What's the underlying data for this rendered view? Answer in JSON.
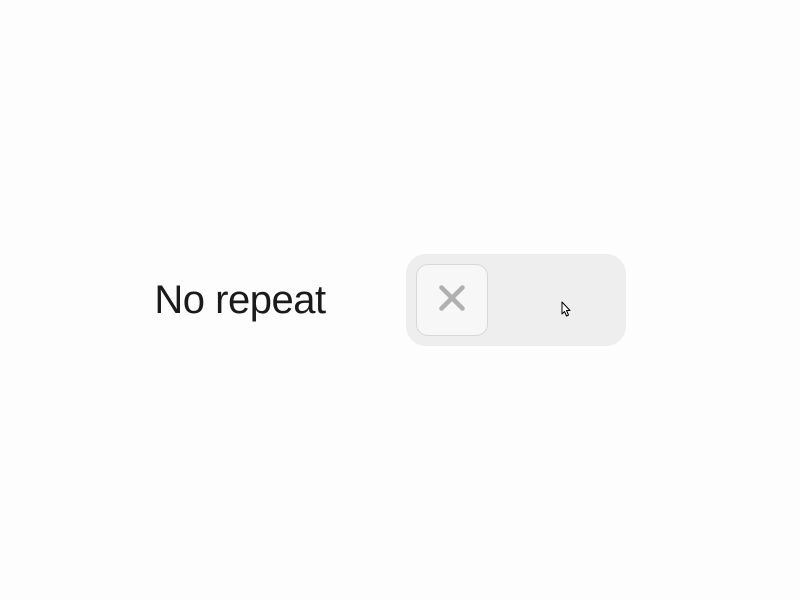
{
  "setting": {
    "label": "No repeat",
    "state": "off"
  },
  "icons": {
    "toggle_icon": "close-icon"
  }
}
